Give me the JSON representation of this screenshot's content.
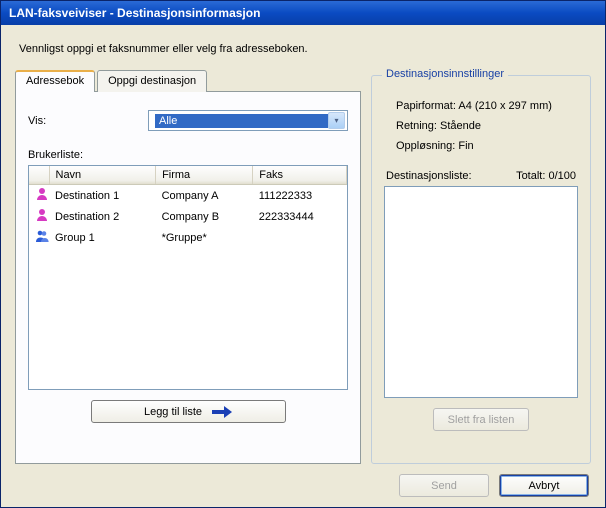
{
  "window": {
    "title": "LAN-faksveiviser - Destinasjonsinformasjon"
  },
  "instruction": "Vennligst oppgi et faksnummer eller velg fra adresseboken.",
  "tabs": {
    "addressbook": "Adressebok",
    "enterdest": "Oppgi destinasjon"
  },
  "vis_label": "Vis:",
  "vis_selected": "Alle",
  "userlist_label": "Brukerliste:",
  "table": {
    "headers": {
      "name": "Navn",
      "company": "Firma",
      "fax": "Faks"
    },
    "rows": [
      {
        "icon": "person",
        "name": "Destination 1",
        "company": "Company A",
        "fax": "111222333"
      },
      {
        "icon": "person",
        "name": "Destination 2",
        "company": "Company B",
        "fax": "222333444"
      },
      {
        "icon": "group",
        "name": "Group 1",
        "company": "*Gruppe*",
        "fax": ""
      }
    ]
  },
  "buttons": {
    "add": "Legg til liste",
    "delete": "Slett fra listen",
    "send": "Send",
    "cancel": "Avbryt"
  },
  "settings": {
    "group_title": "Destinasjonsinnstillinger",
    "paper": "Papirformat: A4 (210 x 297 mm)",
    "orientation": "Retning: Stående",
    "resolution": "Oppløsning: Fin",
    "destlist_label": "Destinasjonsliste:",
    "total_label": "Totalt: 0/100"
  }
}
